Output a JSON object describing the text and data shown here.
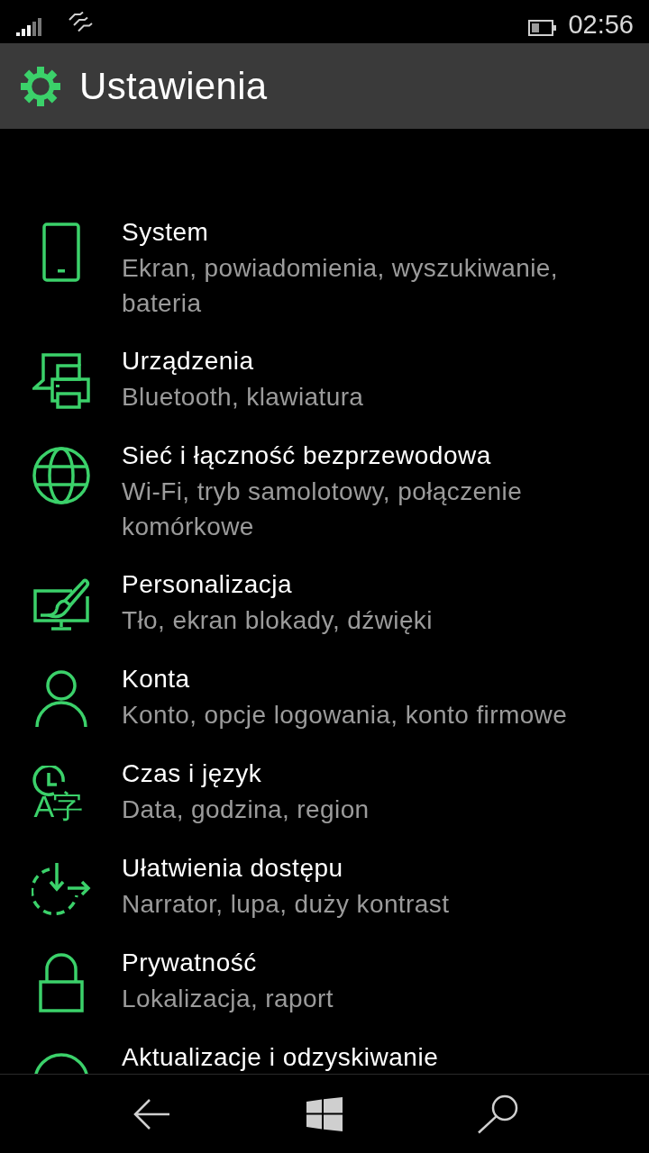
{
  "status_bar": {
    "time": "02:56"
  },
  "header": {
    "title": "Ustawienia"
  },
  "items": [
    {
      "title": "System",
      "subtitle": "Ekran, powiadomienia, wyszukiwanie, bateria"
    },
    {
      "title": "Urządzenia",
      "subtitle": "Bluetooth, klawiatura"
    },
    {
      "title": "Sieć i łączność bezprzewodowa",
      "subtitle": "Wi-Fi, tryb samolotowy, połączenie komórkowe"
    },
    {
      "title": "Personalizacja",
      "subtitle": "Tło, ekran blokady, dźwięki"
    },
    {
      "title": "Konta",
      "subtitle": "Konto, opcje logowania, konto firmowe"
    },
    {
      "title": "Czas i język",
      "subtitle": "Data, godzina, region",
      "icon_text": "A字"
    },
    {
      "title": "Ułatwienia dostępu",
      "subtitle": "Narrator, lupa, duży kontrast"
    },
    {
      "title": "Prywatność",
      "subtitle": "Lokalizacja, raport"
    },
    {
      "title": "Aktualizacje i odzyskiwanie"
    }
  ]
}
